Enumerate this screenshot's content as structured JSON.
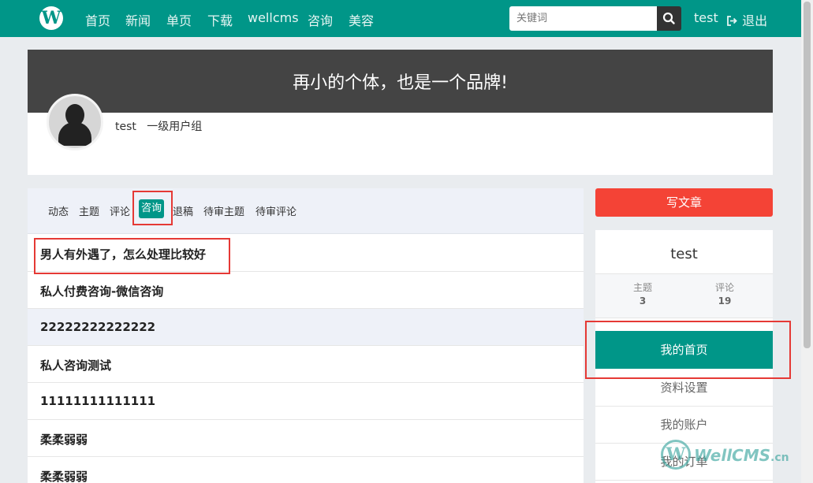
{
  "nav": {
    "logo": "W",
    "items": [
      "首页",
      "新闻",
      "单页",
      "下载",
      "wellcms",
      "咨询",
      "美容"
    ],
    "search_placeholder": "关键词",
    "user": "test",
    "logout": "退出"
  },
  "banner": {
    "slogan": "再小的个体，也是一个品牌!"
  },
  "profile": {
    "name": "test",
    "group": "一级用户组"
  },
  "tabs": {
    "items": [
      "动态",
      "主题",
      "评论",
      "咨询",
      "退稿",
      "待审主题",
      "待审评论"
    ],
    "active": "咨询"
  },
  "list": [
    "男人有外遇了，怎么处理比较好",
    "私人付费咨询-微信咨询",
    "22222222222222",
    "私人咨询测试",
    "11111111111111",
    "柔柔弱弱",
    "柔柔弱弱"
  ],
  "side": {
    "write_label": "写文章",
    "username": "test",
    "stats": [
      {
        "label": "主题",
        "value": "3"
      },
      {
        "label": "评论",
        "value": "19"
      }
    ],
    "home_label": "我的首页",
    "links": [
      "资料设置",
      "我的账户",
      "我的订单"
    ]
  },
  "watermark": {
    "logo": "W",
    "text": "WellCMS",
    "suffix": ".cn"
  },
  "colors": {
    "accent": "#009688",
    "danger": "#f44336",
    "banner": "#444444",
    "annotation": "#e53935"
  }
}
